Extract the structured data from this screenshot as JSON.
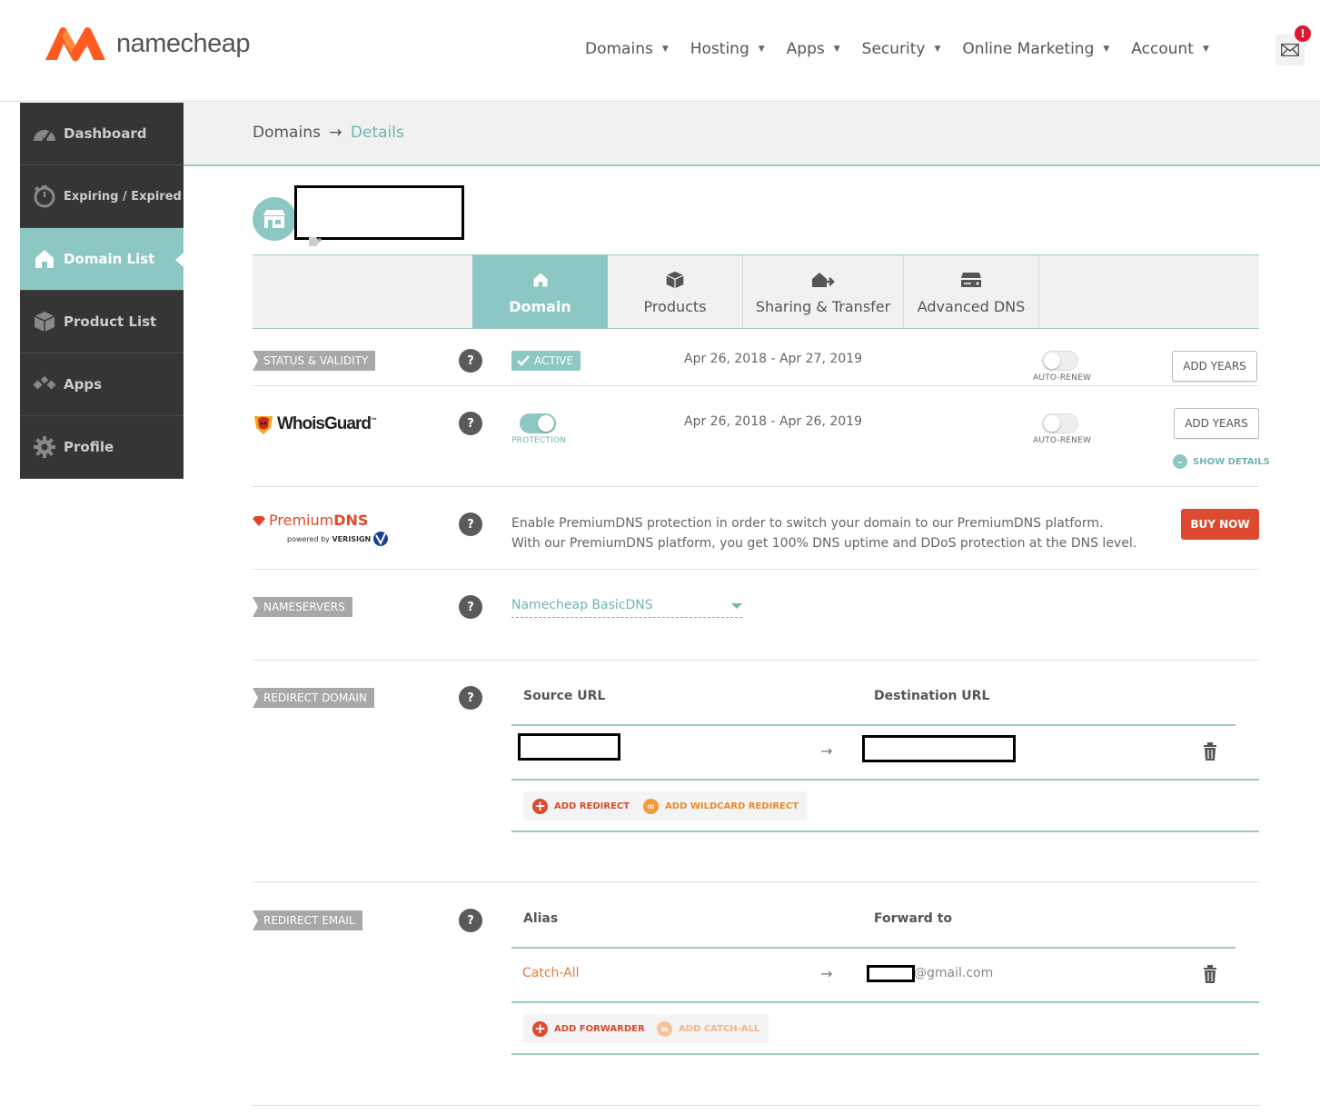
{
  "brand": {
    "logo_text": "namecheap",
    "accent": "#8cc7c3",
    "logo_color": "#ff5a1f"
  },
  "topnav": [
    {
      "label": "Domains"
    },
    {
      "label": "Hosting"
    },
    {
      "label": "Apps"
    },
    {
      "label": "Security"
    },
    {
      "label": "Online Marketing"
    },
    {
      "label": "Account"
    }
  ],
  "mail": {
    "badge": "!"
  },
  "sidebar": {
    "items": [
      {
        "label": "Dashboard",
        "icon": "speedometer-icon"
      },
      {
        "label": "Expiring / Expired",
        "icon": "stopwatch-icon"
      },
      {
        "label": "Domain List",
        "icon": "house-icon",
        "active": true
      },
      {
        "label": "Product List",
        "icon": "box-icon"
      },
      {
        "label": "Apps",
        "icon": "apps-icon"
      },
      {
        "label": "Profile",
        "icon": "gear-icon"
      }
    ]
  },
  "breadcrumb": {
    "parent": "Domains",
    "separator": "→",
    "current": "Details"
  },
  "tabs": [
    {
      "label": "Domain",
      "icon": "house-icon",
      "active": true
    },
    {
      "label": "Products",
      "icon": "box-icon"
    },
    {
      "label": "Sharing & Transfer",
      "icon": "transfer-icon"
    },
    {
      "label": "Advanced DNS",
      "icon": "server-icon"
    }
  ],
  "status": {
    "label": "STATUS & VALIDITY",
    "badge": "ACTIVE",
    "dates": "Apr 26, 2018 - Apr 27, 2019",
    "autorenew_label": "AUTO-RENEW",
    "button": "ADD YEARS"
  },
  "whoisguard": {
    "brand": "WhoisGuard",
    "tm": "™",
    "toggle_label": "PROTECTION",
    "dates": "Apr 26, 2018 - Apr 26, 2019",
    "autorenew_label": "AUTO-RENEW",
    "button": "ADD YEARS",
    "show_details": "SHOW DETAILS"
  },
  "premiumdns": {
    "brand_a": "Premium",
    "brand_b": "DNS",
    "powered": "powered by",
    "verisign": "VERISIGN",
    "line1": "Enable PremiumDNS protection in order to switch your domain to our PremiumDNS platform.",
    "line2": "With our PremiumDNS platform, you get 100% DNS uptime and DDoS protection at the DNS level.",
    "button": "BUY NOW"
  },
  "nameservers": {
    "label": "NAMESERVERS",
    "value": "Namecheap BasicDNS"
  },
  "redirect_domain": {
    "label": "REDIRECT DOMAIN",
    "col_source": "Source URL",
    "col_dest": "Destination URL",
    "arrow": "→",
    "add_redirect": "ADD REDIRECT",
    "add_wildcard": "ADD WILDCARD REDIRECT"
  },
  "redirect_email": {
    "label": "REDIRECT EMAIL",
    "col_alias": "Alias",
    "col_forward": "Forward to",
    "alias": "Catch-All",
    "arrow": "→",
    "forward_suffix": "@gmail.com",
    "add_forwarder": "ADD FORWARDER",
    "add_catchall": "ADD CATCH-ALL"
  },
  "help": "?"
}
